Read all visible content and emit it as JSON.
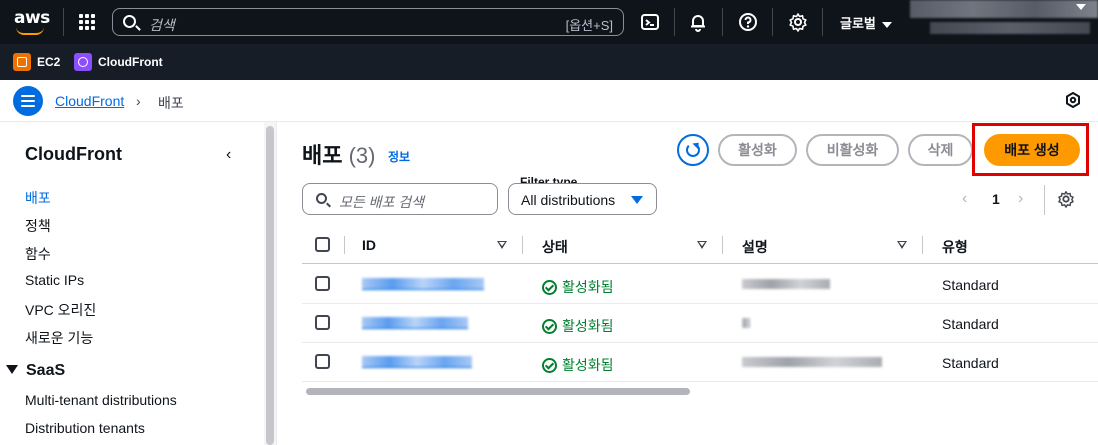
{
  "topbar": {
    "logo_text": "aws",
    "search_placeholder": "검색",
    "search_shortcut": "[옵션+S]",
    "region_label": "글로벌"
  },
  "favorites": [
    {
      "label": "EC2",
      "icon": "ec2-icon",
      "color": "#ed7100"
    },
    {
      "label": "CloudFront",
      "icon": "cloudfront-icon",
      "color": "#8c4fff"
    }
  ],
  "breadcrumb": {
    "service": "CloudFront",
    "separator": "›",
    "current": "배포"
  },
  "sidebar": {
    "title": "CloudFront",
    "items": [
      {
        "label": "배포",
        "active": true
      },
      {
        "label": "정책",
        "active": false
      },
      {
        "label": "함수",
        "active": false
      },
      {
        "label": "Static IPs",
        "active": false
      },
      {
        "label": "VPC 오리진",
        "active": false
      },
      {
        "label": "새로운 기능",
        "active": false
      }
    ],
    "section": {
      "label": "SaaS",
      "items": [
        {
          "label": "Multi-tenant distributions"
        },
        {
          "label": "Distribution tenants"
        }
      ]
    }
  },
  "main": {
    "title": "배포",
    "count": "(3)",
    "info_label": "정보",
    "buttons": {
      "enable": "활성화",
      "disable": "비활성화",
      "delete": "삭제",
      "create": "배포 생성"
    },
    "filter_placeholder": "모든 배포 검색",
    "filter_type_label": "Filter type",
    "filter_type_value": "All distributions",
    "pagination": {
      "prev": "‹",
      "current": "1",
      "next": "›"
    },
    "table": {
      "columns": [
        "ID",
        "상태",
        "설명",
        "유형"
      ],
      "rows": [
        {
          "status": "활성화됨",
          "type": "Standard"
        },
        {
          "status": "활성화됨",
          "type": "Standard"
        },
        {
          "status": "활성화됨",
          "type": "Standard"
        }
      ]
    }
  },
  "colors": {
    "accent": "#006ce0",
    "primary_button": "#ff9900",
    "status_ok": "#00802f",
    "highlight_box": "#e00000"
  }
}
